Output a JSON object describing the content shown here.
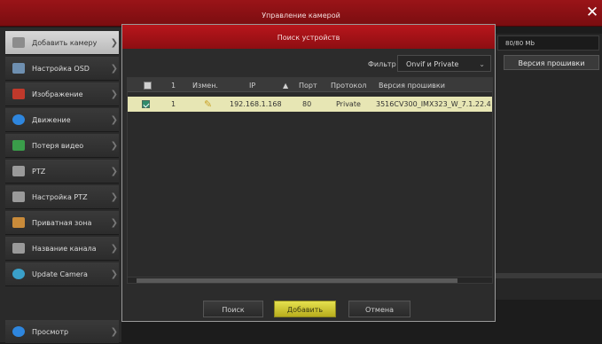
{
  "window": {
    "title": "Управление камерой",
    "close_glyph": "✕"
  },
  "sidebar": {
    "items": [
      {
        "label": "Добавить камеру",
        "icon": "camera-add-icon",
        "color": "#7a7a7a"
      },
      {
        "label": "Настройка OSD",
        "icon": "osd-icon",
        "color": "#6e8fb0"
      },
      {
        "label": "Изображение",
        "icon": "image-icon",
        "color": "#c0392b"
      },
      {
        "label": "Движение",
        "icon": "motion-icon",
        "color": "#2e86de"
      },
      {
        "label": "Потеря видео",
        "icon": "video-loss-icon",
        "color": "#3a9d4a"
      },
      {
        "label": "PTZ",
        "icon": "ptz-icon",
        "color": "#8a8a8a"
      },
      {
        "label": "Настройка PTZ",
        "icon": "ptz-settings-icon",
        "color": "#8a8a8a"
      },
      {
        "label": "Приватная зона",
        "icon": "privacy-icon",
        "color": "#c98b3a"
      },
      {
        "label": "Название канала",
        "icon": "channel-name-icon",
        "color": "#8a8a8a"
      },
      {
        "label": "Update Camera",
        "icon": "update-icon",
        "color": "#3aa0c9"
      }
    ],
    "view_label": "Просмотр",
    "view_icon": "view-icon"
  },
  "behind_panel": {
    "storage": "80/80 Mb",
    "firmware_header": "Версия прошивки"
  },
  "dialog": {
    "title": "Поиск устройств",
    "filter_label": "Фильтр",
    "filter_value": "Onvif и Private",
    "columns": [
      "1",
      "Измен.",
      "IP",
      "Порт",
      "Протокол",
      "Версия прошивки"
    ],
    "rows": [
      {
        "checked": true,
        "num": "1",
        "ip": "192.168.1.168",
        "port": "80",
        "protocol": "Private",
        "firmware": "3516CV300_IMX323_W_7.1.22.4"
      }
    ],
    "buttons": {
      "search": "Поиск",
      "add": "Добавить",
      "cancel": "Отмена"
    }
  },
  "colors": {
    "title_red": "#9a1418",
    "row_highlight": "#e7e6b4",
    "primary_button": "#d8cf34"
  }
}
